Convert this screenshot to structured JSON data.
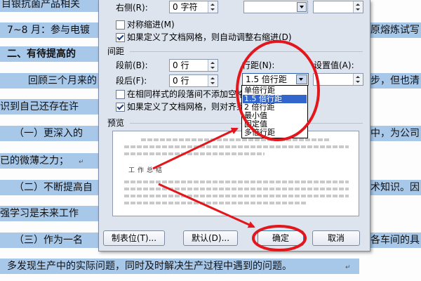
{
  "document": {
    "lines": [
      {
        "text": "目银抗菌产品相关",
        "bold": false
      },
      {
        "text": "7~8 月：参与电镀",
        "bold": false,
        "right": "原熔炼试写"
      },
      {
        "text": "二、有待提高的",
        "bold": true
      },
      {
        "text": "回顾三个月来的",
        "bold": false,
        "right": "步，但也清"
      },
      {
        "text": "识到自己还存在许",
        "bold": false
      },
      {
        "text": "（一）更深入的",
        "bold": false,
        "right": "中，为公司"
      },
      {
        "text": "已的微薄之力；",
        "bold": false,
        "ret": "↵"
      },
      {
        "text": "（二）不断提高自",
        "bold": false,
        "right": "术知识。因"
      },
      {
        "text": "强学习是未来工作",
        "bold": false
      },
      {
        "text": "（三）作为一名",
        "bold": false,
        "right": "各车间的具"
      },
      {
        "text": "多发现生产中的实际问题，同时及时解决生产过程中遇到的问题。",
        "bold": false,
        "ret": "↵"
      }
    ]
  },
  "dialog": {
    "indent": {
      "right_label": "右侧(R):",
      "right_value": "0 字符",
      "mirror_label": "对称缩进(M)",
      "mirror_checked": false,
      "grid_label": "如果定义了文档网格，则自动调整右缩进(D)",
      "grid_checked": true
    },
    "spacing": {
      "section_label": "间距",
      "before_label": "段前(B):",
      "before_value": "0 行",
      "after_label": "段后(F):",
      "after_value": "0 行",
      "same_style_label": "在相同样式的段落间不添加空格",
      "same_style_checked": false,
      "snap_label": "如果定义了文档网格，则对齐到",
      "snap_checked": true,
      "line_label": "行距(N):",
      "line_value": "1.5 倍行距",
      "setting_label": "设置值(A):",
      "line_options": [
        "单倍行距",
        "1.5 倍行距",
        "2 倍行距",
        "最小值",
        "固定值",
        "多倍行距"
      ],
      "line_selected_index": 1
    },
    "preview": {
      "label": "预览",
      "sample_text": "工作总结"
    },
    "buttons": {
      "tabs": "制表位(T)...",
      "default": "默认(D)...",
      "ok": "确定",
      "cancel": "取消"
    }
  },
  "colors": {
    "highlight": "#a8c8ea",
    "annotation": "#e3161c",
    "selection": "#3366cc"
  }
}
